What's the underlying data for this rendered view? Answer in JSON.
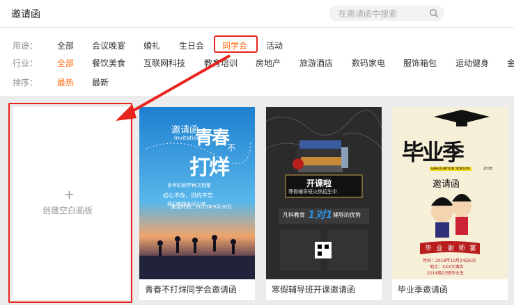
{
  "header": {
    "title": "邀请函",
    "search_placeholder": "在邀请函中搜索"
  },
  "filters": {
    "usage": {
      "label": "用途：",
      "options": [
        "全部",
        "会议晚宴",
        "婚礼",
        "生日会",
        "同学会",
        "活动"
      ]
    },
    "industry": {
      "label": "行业：",
      "options": [
        "全部",
        "餐饮美食",
        "互联网科技",
        "教育培训",
        "房地产",
        "旅游酒店",
        "数码家电",
        "服饰箱包",
        "运动健身",
        "金"
      ]
    },
    "sort": {
      "label": "排序：",
      "options": [
        "最热",
        "最新"
      ]
    }
  },
  "blank": {
    "label": "创建空白画板",
    "plus": "+"
  },
  "cards": [
    {
      "caption": "青春不打烊同学会邀请函",
      "poster": {
        "head": "邀请函",
        "sub": "Invitation",
        "big1": "青春",
        "big2": "打烊",
        "small": "不",
        "lines": [
          "多年的同学再次相聚",
          "初心不改，旧约不忘",
          "我们都是此间少年",
          "聚会时间：2019年9月30日"
        ]
      }
    },
    {
      "caption": "寒假辅导班开课邀请函",
      "poster": {
        "banner": "开课啦",
        "banner_sub": "寒假辅导班火热招生中",
        "l1": "凡科教育",
        "l2": "1对1",
        "l3": "辅导的优势"
      }
    },
    {
      "caption": "毕业季邀请函",
      "poster": {
        "big": "毕业季",
        "badge": "GRADUATION SEASON",
        "year": "2018",
        "sub": "邀请函",
        "banner": [
          "毕",
          "业",
          "谢",
          "师",
          "宴"
        ],
        "info": [
          "时间：2018年10月24日6点",
          "地点：XXX大酒店",
          "2014级03班毕业生"
        ]
      }
    }
  ]
}
